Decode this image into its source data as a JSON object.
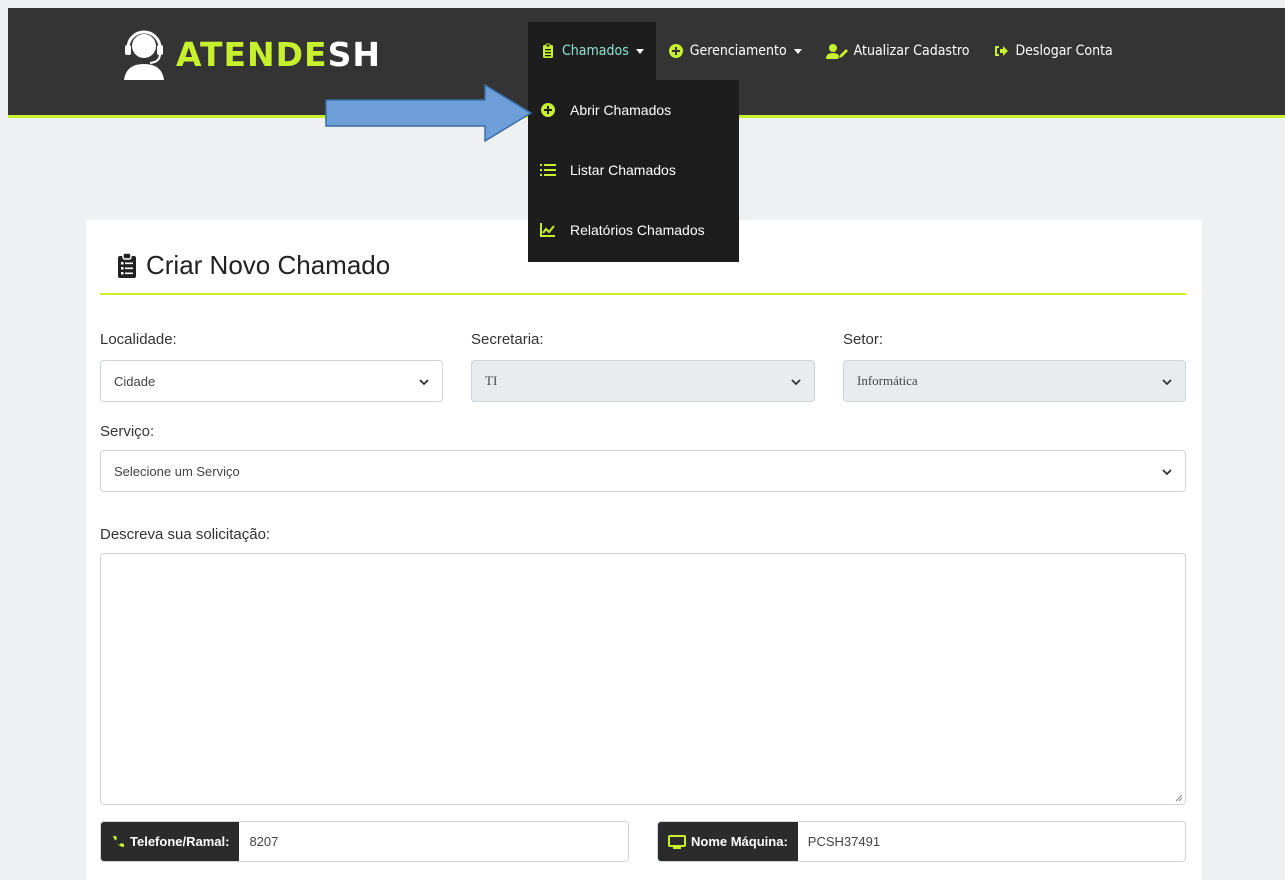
{
  "brand": {
    "part1": "ATENDE",
    "part2": "SH",
    "accent": "#c8f02c"
  },
  "nav": {
    "items": [
      {
        "label": "Chamados",
        "icon": "clipboard-icon",
        "active": true,
        "dropdown": true
      },
      {
        "label": "Gerenciamento",
        "icon": "plus-circle-icon",
        "dropdown": true
      },
      {
        "label": "Atualizar Cadastro",
        "icon": "user-edit-icon"
      },
      {
        "label": "Deslogar Conta",
        "icon": "sign-out-icon"
      }
    ]
  },
  "dropdown": {
    "items": [
      {
        "label": "Abrir Chamados",
        "icon": "plus-circle-icon"
      },
      {
        "label": "Listar Chamados",
        "icon": "list-icon"
      },
      {
        "label": "Relatórios Chamados",
        "icon": "chart-line-icon"
      }
    ]
  },
  "form": {
    "title": "Criar Novo Chamado",
    "localidade": {
      "label": "Localidade:",
      "value": "Cidade"
    },
    "secretaria": {
      "label": "Secretaria:",
      "value": "TI"
    },
    "setor": {
      "label": "Setor:",
      "value": "Informática"
    },
    "servico": {
      "label": "Serviço:",
      "value": "Selecione um Serviço"
    },
    "descricao": {
      "label": "Descreva sua solicitação:",
      "value": ""
    },
    "telefone": {
      "label": "Telefone/Ramal:",
      "value": "8207"
    },
    "maquina": {
      "label": "Nome Máquina:",
      "value": "PCSH37491"
    }
  }
}
